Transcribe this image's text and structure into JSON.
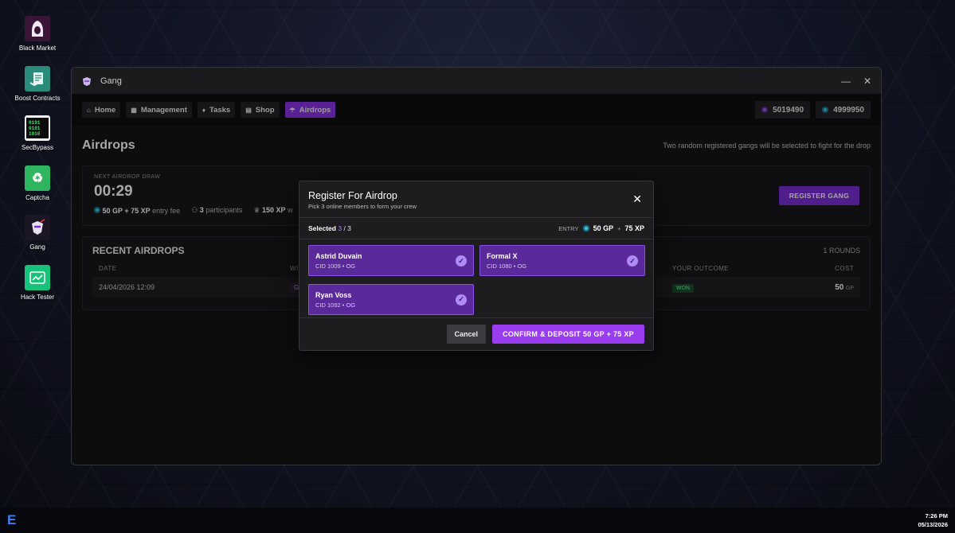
{
  "desktop": {
    "icons": [
      {
        "label": "Black Market",
        "icon": "hood-icon"
      },
      {
        "label": "Boost Contracts",
        "icon": "contract-icon"
      },
      {
        "label": "SecBypass",
        "icon": "binary-icon",
        "glyph": "0101\n0101\n1010"
      },
      {
        "label": "Captcha",
        "icon": "recycle-icon"
      },
      {
        "label": "Gang",
        "icon": "gang-icon"
      },
      {
        "label": "Hack Tester",
        "icon": "terminal-icon"
      }
    ]
  },
  "window": {
    "title": "Gang",
    "minimize": "—",
    "close": "✕"
  },
  "nav": {
    "items": [
      {
        "label": "Home",
        "icon": "home-icon",
        "glyph": "⌂"
      },
      {
        "label": "Management",
        "icon": "building-icon",
        "glyph": "▦"
      },
      {
        "label": "Tasks",
        "icon": "trophy-icon",
        "glyph": "♦"
      },
      {
        "label": "Shop",
        "icon": "store-icon",
        "glyph": "▤"
      },
      {
        "label": "Airdrops",
        "icon": "parachute-icon",
        "glyph": "☂",
        "active": true
      }
    ]
  },
  "balances": {
    "gp": "5019490",
    "xp": "4999950"
  },
  "page": {
    "title": "Airdrops",
    "hint": "Two random registered gangs will be selected to fight for the drop"
  },
  "draw": {
    "caption": "NEXT AIRDROP DRAW",
    "timer": "00:29",
    "fee_value": "50 GP + 75 XP",
    "fee_label": "entry fee",
    "participants_value": "3",
    "participants_label": "participants",
    "reward_value": "150 XP",
    "reward_label": "w",
    "register_label": "REGISTER GANG"
  },
  "recent": {
    "title": "RECENT AIRDROPS",
    "rounds": "1 ROUNDS",
    "headers": {
      "date": "DATE",
      "winner": "WI",
      "outcome": "YOUR OUTCOME",
      "cost": "COST"
    },
    "rows": [
      {
        "date": "24/04/2026 12:09",
        "winner": "Gi",
        "outcome": "WON",
        "cost_value": "50",
        "cost_unit": "GP"
      }
    ]
  },
  "modal": {
    "title": "Register For Airdrop",
    "subtitle": "Pick 3 online members to form your crew",
    "close": "✕",
    "selected_label": "Selected",
    "selected_count": "3",
    "selected_total": "/ 3",
    "entry_label": "ENTRY",
    "entry_gp": "50 GP",
    "entry_plus": "+",
    "entry_xp": "75 XP",
    "members": [
      {
        "name": "Astrid Duvain",
        "info": "CID 1009 • OG",
        "selected": true
      },
      {
        "name": "Formal X",
        "info": "CID 1080 • OG",
        "selected": true
      },
      {
        "name": "Ryan Voss",
        "info": "CID 1092 • OG",
        "selected": true
      }
    ],
    "check_glyph": "✓",
    "cancel_label": "Cancel",
    "confirm_label": "CONFIRM & DEPOSIT 50 GP + 75 XP"
  },
  "taskbar": {
    "logo": "E",
    "time": "7:26 PM",
    "date": "05/13/2026"
  },
  "colors": {
    "accent": "#8b34e6",
    "gp": "#a15cf0",
    "xp": "#3bc8df",
    "won": "#4ccb7a"
  }
}
